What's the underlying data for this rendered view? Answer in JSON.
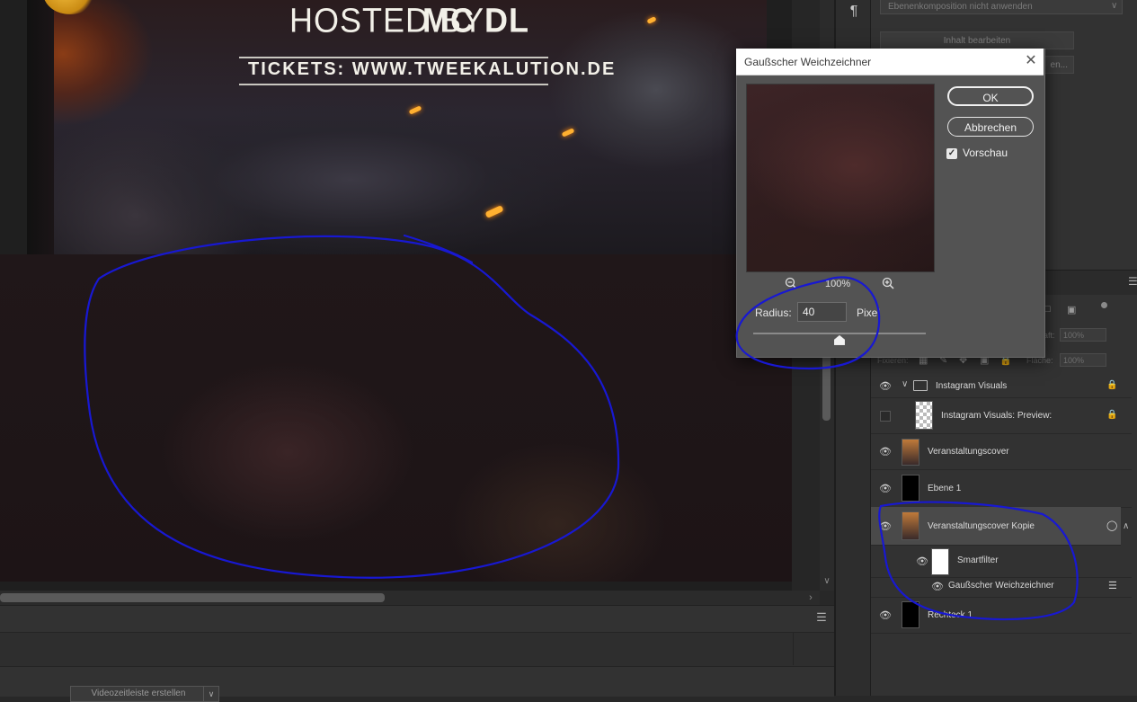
{
  "document": {
    "hosted_prefix": "HOSTED BY",
    "hosted_name": "MC DL",
    "tickets_line": "TICKETS: WWW.TWEEKALUTION.DE"
  },
  "right_panel": {
    "paragraph_icon": "¶",
    "layer_comp_select": "Ebenenkomposition nicht anwenden",
    "edit_content_button": "Inhalt bearbeiten",
    "second_button_suffix": "en..."
  },
  "layers_panel": {
    "opacity_label": "raft:",
    "opacity_value": "100%",
    "lock_label": "Fixieren:",
    "fill_label": "Fläche:",
    "fill_value": "100%",
    "layers": [
      {
        "name": "Instagram Visuals"
      },
      {
        "name": "Instagram Visuals: Preview:"
      },
      {
        "name": "Veranstaltungscover"
      },
      {
        "name": "Ebene 1"
      },
      {
        "name": "Veranstaltungscover Kopie"
      },
      {
        "name": "Smartfilter"
      },
      {
        "name": "Gaußscher Weichzeichner"
      },
      {
        "name": "Rechteck 1"
      }
    ]
  },
  "bottom_panel": {
    "video_button": "Videozeitleiste erstellen"
  },
  "dialog": {
    "title": "Gaußscher Weichzeichner",
    "ok": "OK",
    "cancel": "Abbrechen",
    "preview_label": "Vorschau",
    "preview_checked": true,
    "zoom_level": "100%",
    "radius_label": "Radius:",
    "radius_value": "40",
    "radius_unit": "Pixel",
    "slider_level": 0.5
  },
  "colors": {
    "annotation": "#1a1ad0",
    "panel_bg": "#323232",
    "dialog_bg": "#535353"
  }
}
